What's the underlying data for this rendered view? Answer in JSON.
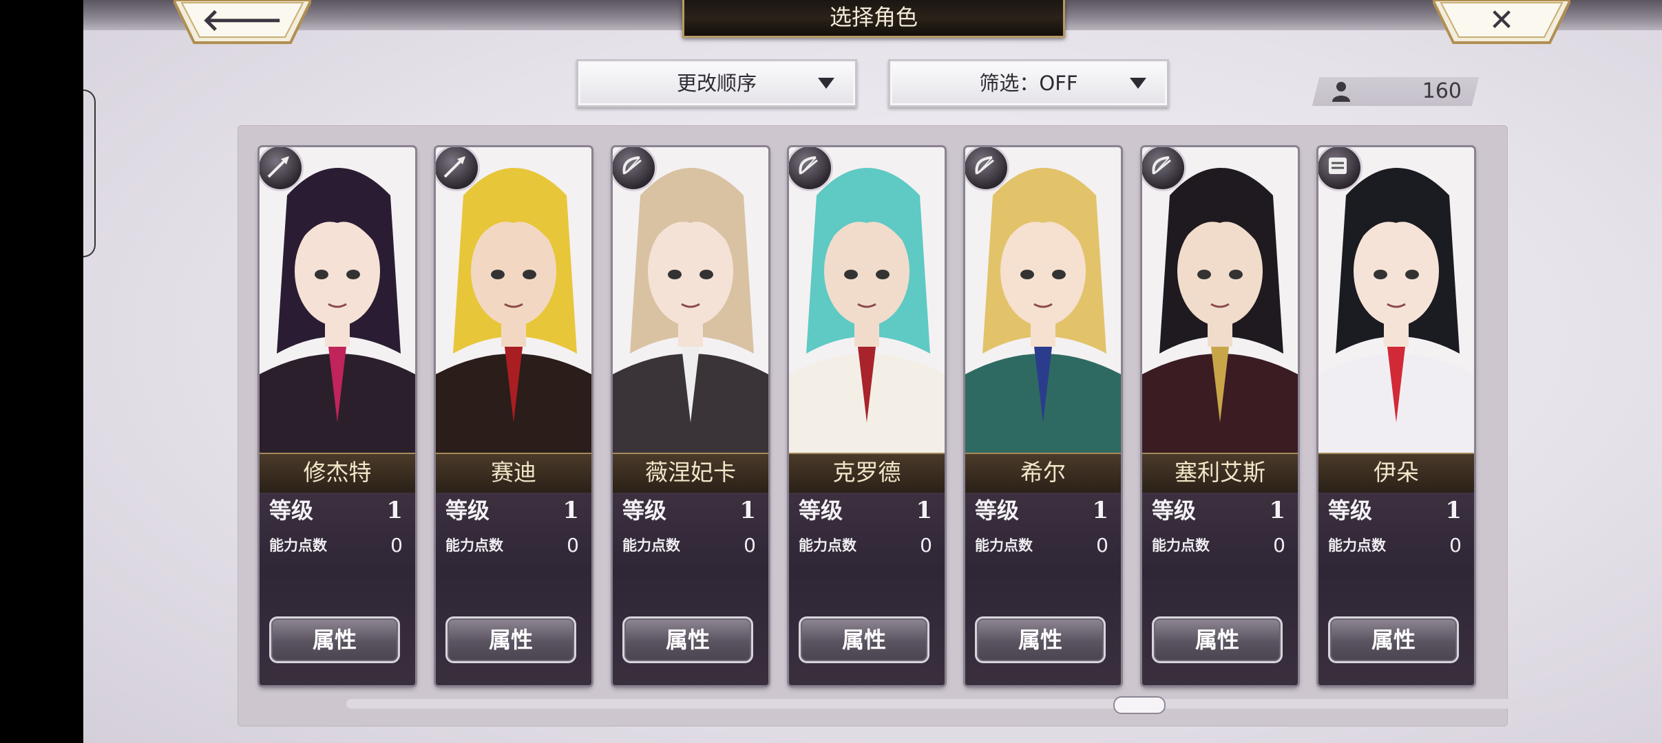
{
  "header": {
    "title": "选择角色",
    "back_icon": "arrow-left-icon",
    "close_icon": "close-x-icon"
  },
  "toolbar": {
    "sort_label": "更改顺序",
    "filter_label": "筛选：OFF",
    "count_icon": "person-icon",
    "count": "160"
  },
  "labels": {
    "level": "等级",
    "ability_points": "能力点数",
    "attr_button": "属性"
  },
  "characters": [
    {
      "name": "修杰特",
      "level": "1",
      "points": "0",
      "role_icon": "spear-icon",
      "hair": "#2a1d33",
      "skin": "#f6e1d6",
      "outfit": "#2c1f2c",
      "accent": "#c0245a"
    },
    {
      "name": "赛迪",
      "level": "1",
      "points": "0",
      "role_icon": "spear-icon",
      "hair": "#e8c63a",
      "skin": "#f2d8c2",
      "outfit": "#2a1d1a",
      "accent": "#a81e22"
    },
    {
      "name": "薇涅妃卡",
      "level": "1",
      "points": "0",
      "role_icon": "bow-icon",
      "hair": "#d9c2a2",
      "skin": "#f5e2d6",
      "outfit": "#3a3438",
      "accent": "#eeeeee"
    },
    {
      "name": "克罗德",
      "level": "1",
      "points": "0",
      "role_icon": "bow-icon",
      "hair": "#5fc9c4",
      "skin": "#f1dccb",
      "outfit": "#f3efe6",
      "accent": "#a8232b"
    },
    {
      "name": "希尔",
      "level": "1",
      "points": "0",
      "role_icon": "bow-icon",
      "hair": "#e2c36a",
      "skin": "#f6e0cf",
      "outfit": "#2f6a62",
      "accent": "#2b3c8c"
    },
    {
      "name": "塞利艾斯",
      "level": "1",
      "points": "0",
      "role_icon": "bow-icon",
      "hair": "#1f1a1f",
      "skin": "#f1dccb",
      "outfit": "#3a1c22",
      "accent": "#c9a54a"
    },
    {
      "name": "伊朵",
      "level": "1",
      "points": "0",
      "role_icon": "shield-icon",
      "hair": "#1b1b22",
      "skin": "#f6e3d8",
      "outfit": "#f1eef3",
      "accent": "#d12a36"
    }
  ]
}
